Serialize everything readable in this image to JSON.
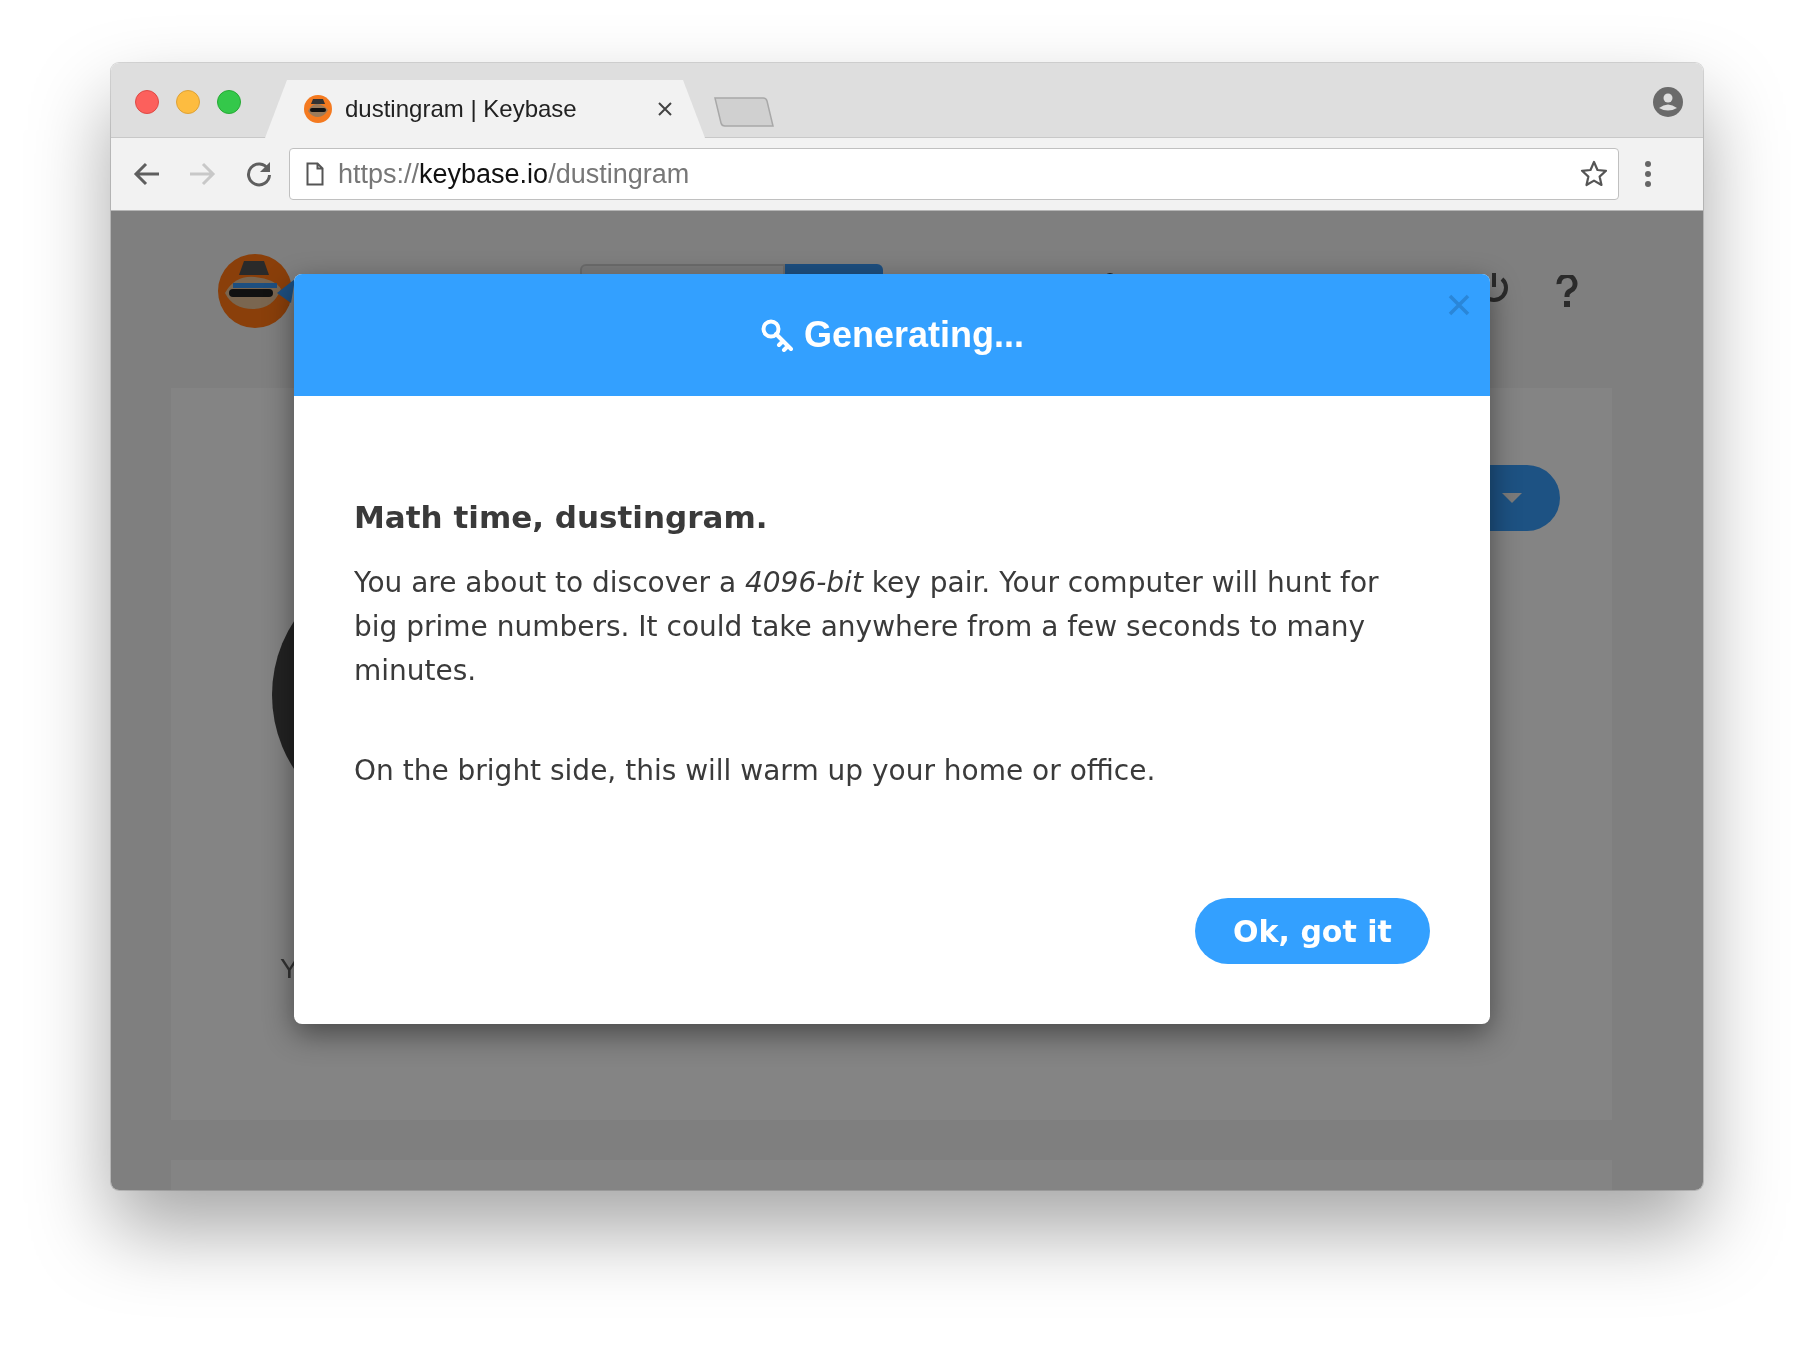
{
  "browser": {
    "tabs": [
      {
        "title": "dustingram | Keybase",
        "selected": true
      }
    ],
    "nav": {
      "back_disabled": false,
      "forward_disabled": true
    },
    "address": {
      "scheme": "https://",
      "host": "keybase.io",
      "path": "/dustingram"
    }
  },
  "background_page": {
    "partial_text": "Y"
  },
  "modal": {
    "title": "Generating...",
    "heading": "Math time, dustingram.",
    "paragraphs": [
      "You are about to discover a *4096-bit* key pair. Your computer will hunt for big prime numbers. It could take anywhere from a few seconds to many minutes.",
      "On the bright side, this will warm up your home or office."
    ],
    "button": "Ok, got it"
  }
}
